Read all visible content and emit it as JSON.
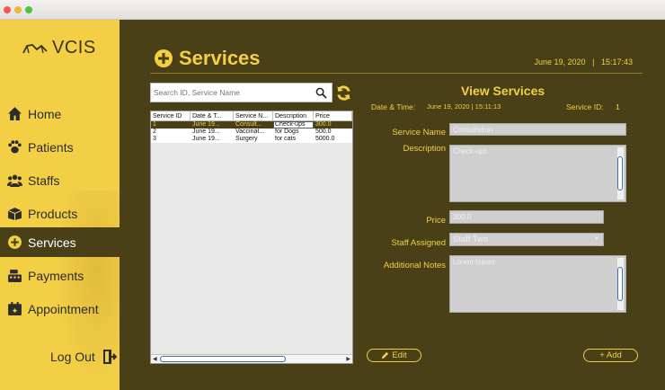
{
  "app": {
    "logo_text": "VCIS"
  },
  "sidebar": {
    "items": [
      {
        "label": "Home",
        "icon": "home-icon"
      },
      {
        "label": "Patients",
        "icon": "paw-icon"
      },
      {
        "label": "Staffs",
        "icon": "users-icon"
      },
      {
        "label": "Products",
        "icon": "box-icon"
      },
      {
        "label": "Services",
        "icon": "plus-circle-icon",
        "active": true
      },
      {
        "label": "Payments",
        "icon": "cash-register-icon"
      },
      {
        "label": "Appointment",
        "icon": "calendar-icon"
      }
    ],
    "logout_label": "Log Out"
  },
  "header": {
    "title": "Services",
    "date": "June 19, 2020",
    "separator": "|",
    "time": "15:17:43"
  },
  "search": {
    "placeholder": "Search ID, Service Name"
  },
  "table": {
    "columns": [
      "Service ID",
      "Date & T...",
      "Service N...",
      "Description",
      "Price"
    ],
    "rows": [
      [
        "1",
        "June 19...",
        "Consult...",
        "Check-ups",
        "300.0"
      ],
      [
        "2",
        "June 19...",
        "Vaccinat...",
        "for Dogs",
        "500.0"
      ],
      [
        "3",
        "June 19...",
        "Surgery",
        "for cats",
        "5000.0"
      ]
    ],
    "selected_row": 0
  },
  "details": {
    "title": "View Services",
    "datetime_label": "Date & Time:",
    "datetime_value": "June 19, 2020   |   15:11:13",
    "service_id_label": "Service ID:",
    "service_id_value": "1",
    "service_name_label": "Service Name",
    "service_name_value": "Consultation",
    "description_label": "Description",
    "description_value": "Check-ups",
    "price_label": "Price",
    "price_value": "300.0",
    "staff_label": "Staff Assigned",
    "staff_value": "Staff Two",
    "notes_label": "Additional Notes",
    "notes_value": "Lorem Ipsum"
  },
  "buttons": {
    "edit": "Edit",
    "add": "+ Add"
  },
  "colors": {
    "accent": "#f3cf46",
    "panel": "#4a4018",
    "sidebar": "#f3cf46"
  }
}
